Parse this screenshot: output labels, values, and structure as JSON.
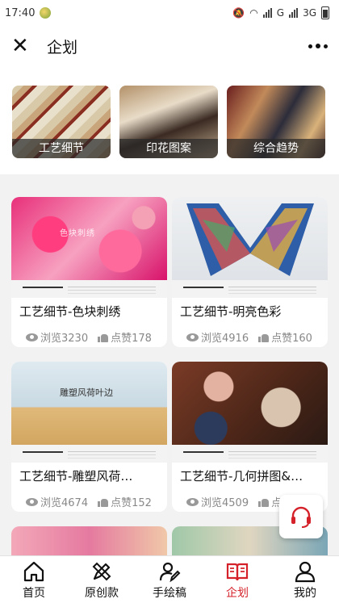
{
  "status_bar": {
    "time": "17:40",
    "network": "G",
    "network2": "3G"
  },
  "header": {
    "title": "企划",
    "close_icon": "close-icon",
    "more_icon": "more-icon"
  },
  "categories": [
    {
      "label": "工艺细节"
    },
    {
      "label": "印花图案"
    },
    {
      "label": "综合趋势"
    }
  ],
  "cards": [
    {
      "title": "工艺细节-色块刺绣",
      "views": "浏览3230",
      "likes": "点赞178",
      "overlay": "色块刺绣"
    },
    {
      "title": "工艺细节-明亮色彩",
      "views": "浏览4916",
      "likes": "点赞160",
      "overlay": ""
    },
    {
      "title": "工艺细节-雕塑风荷…",
      "views": "浏览4674",
      "likes": "点赞152",
      "overlay": "雕塑风荷叶边"
    },
    {
      "title": "工艺细节-几何拼图&…",
      "views": "浏览4509",
      "likes": "点赞155",
      "overlay": ""
    }
  ],
  "tabs": [
    {
      "label": "首页",
      "icon": "home-icon"
    },
    {
      "label": "原创款",
      "icon": "pencil-ruler-icon"
    },
    {
      "label": "手绘稿",
      "icon": "user-pen-icon"
    },
    {
      "label": "企划",
      "icon": "book-icon",
      "active": true
    },
    {
      "label": "我的",
      "icon": "person-icon"
    }
  ],
  "colors": {
    "accent": "#d5222a",
    "background": "#f2f2f2"
  }
}
